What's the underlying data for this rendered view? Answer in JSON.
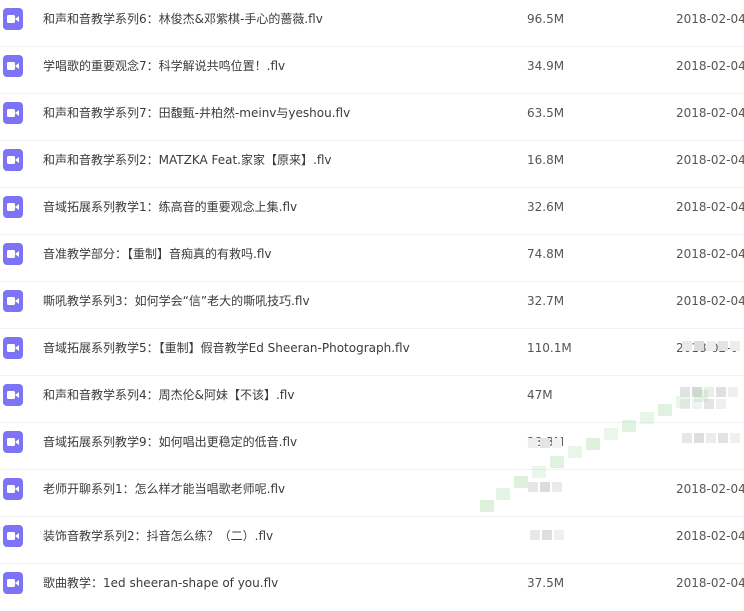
{
  "files": [
    {
      "name": "和声和音教学系列6：林俊杰&邓紫棋-手心的蔷薇.flv",
      "size": "96.5M",
      "date": "2018-02-04",
      "icon": "video-file-icon"
    },
    {
      "name": "学唱歌的重要观念7：科学解说共鸣位置！.flv",
      "size": "34.9M",
      "date": "2018-02-04",
      "icon": "video-file-icon"
    },
    {
      "name": "和声和音教学系列7：田馥甄-井柏然-meinv与yeshou.flv",
      "size": "63.5M",
      "date": "2018-02-04",
      "icon": "video-file-icon"
    },
    {
      "name": "和声和音教学系列2：MATZKA Feat.家家【原来】.flv",
      "size": "16.8M",
      "date": "2018-02-04",
      "icon": "video-file-icon"
    },
    {
      "name": "音域拓展系列教学1：练高音的重要观念上集.flv",
      "size": "32.6M",
      "date": "2018-02-04",
      "icon": "video-file-icon"
    },
    {
      "name": "音准教学部分：【重制】音痴真的有救吗.flv",
      "size": "74.8M",
      "date": "2018-02-04",
      "icon": "video-file-icon"
    },
    {
      "name": "嘶吼教学系列3：如何学会“信”老大的嘶吼技巧.flv",
      "size": "32.7M",
      "date": "2018-02-04",
      "icon": "video-file-icon"
    },
    {
      "name": "音域拓展系列教学5：【重制】假音教学Ed Sheeran-Photograph.flv",
      "size": "110.1M",
      "date": "2018-02-0",
      "icon": "video-file-icon"
    },
    {
      "name": "和声和音教学系列4：周杰伦&阿妹【不该】.flv",
      "size": "47M",
      "date": "",
      "icon": "video-file-icon"
    },
    {
      "name": "音域拓展系列教学9：如何唱出更稳定的低音.flv",
      "size": "28.3M",
      "date": "",
      "icon": "video-file-icon"
    },
    {
      "name": "老师开聊系列1：怎么样才能当唱歌老师呢.flv",
      "size": "",
      "date": "2018-02-04",
      "icon": "video-file-icon"
    },
    {
      "name": "装饰音教学系列2：抖音怎么练？（二）.flv",
      "size": "",
      "date": "2018-02-04",
      "icon": "video-file-icon"
    },
    {
      "name": "歌曲教学：1ed sheeran-shape of you.flv",
      "size": "37.5M",
      "date": "2018-02-04",
      "icon": "video-file-icon"
    }
  ],
  "colors": {
    "icon_bg": "#7c74f5",
    "text": "#3b3b3b",
    "meta_text": "#555555",
    "row_divider": "#f1f2f5"
  }
}
